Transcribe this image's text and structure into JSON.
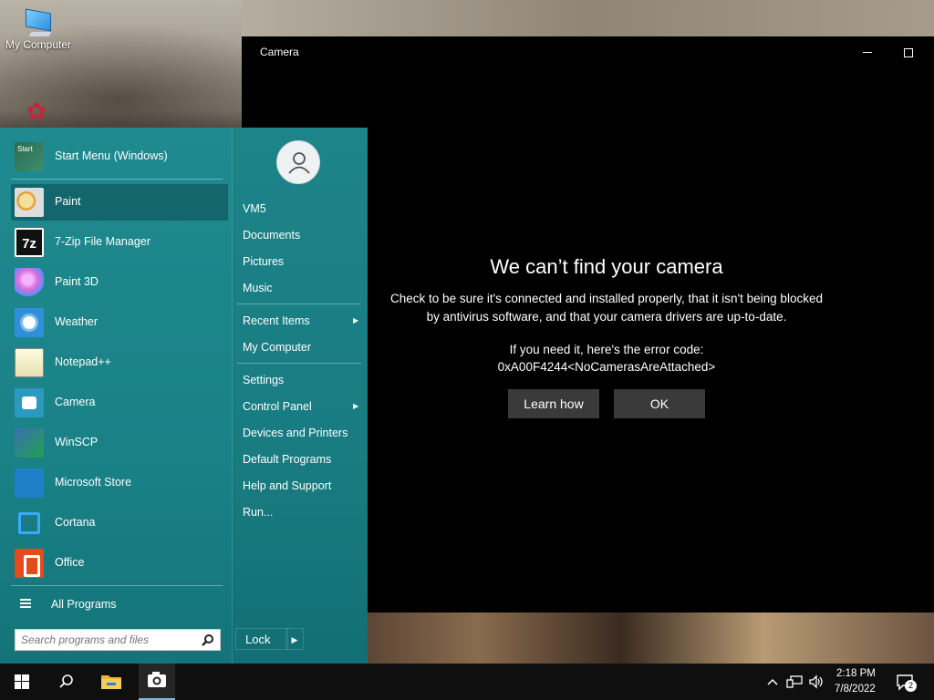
{
  "desktop": {
    "icons": [
      {
        "label": "My Computer",
        "icon": "computer-icon"
      },
      {
        "label": "",
        "icon": "lotus-app-icon"
      }
    ]
  },
  "camera_window": {
    "title": "Camera",
    "heading": "We can’t find your camera",
    "body_line1": "Check to be sure it's connected and installed properly, that it isn't being blocked",
    "body_line2": "by antivirus software, and that your camera drivers are up-to-date.",
    "code_intro": "If you need it, here's the error code:",
    "error_code": "0xA00F4244<NoCamerasAreAttached>",
    "learn_button": "Learn how",
    "ok_button": "OK"
  },
  "start_menu": {
    "header_item": {
      "label": "Start Menu (Windows)",
      "icon": "start-menu-icon"
    },
    "pinned": [
      {
        "label": "Paint",
        "icon": "paint-icon",
        "selected": true
      },
      {
        "label": "7-Zip File Manager",
        "icon": "7zip-icon"
      },
      {
        "label": "Paint 3D",
        "icon": "paint3d-icon"
      },
      {
        "label": "Weather",
        "icon": "weather-icon"
      },
      {
        "label": "Notepad++",
        "icon": "notepad-plus-plus-icon"
      },
      {
        "label": "Camera",
        "icon": "camera-icon"
      },
      {
        "label": "WinSCP",
        "icon": "winscp-icon"
      },
      {
        "label": "Microsoft Store",
        "icon": "microsoft-store-icon"
      },
      {
        "label": "Cortana",
        "icon": "cortana-icon"
      },
      {
        "label": "Office",
        "icon": "office-icon"
      }
    ],
    "all_programs": "All Programs",
    "search_placeholder": "Search programs and files",
    "right_links": {
      "user": "VM5",
      "documents": "Documents",
      "pictures": "Pictures",
      "music": "Music",
      "recent_items": "Recent Items",
      "my_computer": "My Computer",
      "settings": "Settings",
      "control_panel": "Control Panel",
      "devices_printers": "Devices and Printers",
      "default_programs": "Default Programs",
      "help_support": "Help and Support",
      "run": "Run..."
    },
    "lock_button": "Lock"
  },
  "taskbar": {
    "time": "2:18 PM",
    "date": "7/8/2022",
    "notification_count": "2"
  },
  "colors": {
    "start_menu_teal": "#1f8a8f",
    "camera_bg": "#000000",
    "camera_button": "#3a3a3a",
    "taskbar": "#0f0f0f"
  }
}
